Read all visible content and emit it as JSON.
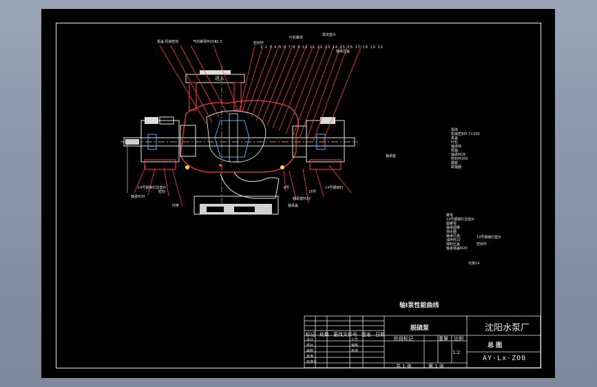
{
  "drawing": {
    "caption": "轴I泵性能曲线",
    "inlet_label": "进入",
    "side_label": "轴承座"
  },
  "title_block": {
    "product_name": "脱硫泵",
    "company": "沈阳水泵厂",
    "drawing_title": "总 图",
    "drawing_number": "AY-Lx-Z00",
    "scale": "1:2",
    "header_cells": [
      "标记",
      "处数",
      "更改文件号",
      "签名",
      "日期"
    ],
    "row_labels": [
      "设计",
      "校对",
      "审核",
      "批准",
      "标准化"
    ],
    "mid_labels": [
      "工艺",
      "审核",
      "批准"
    ],
    "stage_label": "阶段标记",
    "weight_label": "重量",
    "scale_label": "比例",
    "sheet_total": "共 1 张",
    "sheet_index": "第 1 张"
  },
  "right_notes": {
    "upper": [
      "泵体",
      "机械密封0.7×200",
      "泵盖",
      "叶轮",
      "轴承体",
      "泵轴",
      "轴承M28",
      "密封环200",
      "轴套",
      "联轴器"
    ],
    "lower": [
      "螺母",
      "14号钢铆钉及垫片",
      "圆螺母",
      "轴承圆锥",
      "挡水圈",
      "轴承压盖",
      "油杯M10",
      "填料压盖",
      "轴承端盖M20"
    ],
    "side_tags": [
      "14号钢铆钉垫片",
      "密封环",
      "托架14"
    ]
  },
  "top_callouts": [
    "泵盖 机械密封",
    "气封螺母M20×1.5",
    "密封环",
    "5",
    "1 2 3 4 5 6 7 8 9 10 11 12 13 14 15 16 17 18 19 20",
    "叶轮螺母",
    "泵体垫片",
    "轴承压盖"
  ],
  "bottom_callouts": [
    "14号钢铆钉及垫片",
    "轴承M30",
    "密封",
    "托架",
    "8号",
    "轴承垫M20",
    "16号",
    "14号钢铆钉",
    "轴承盖"
  ]
}
